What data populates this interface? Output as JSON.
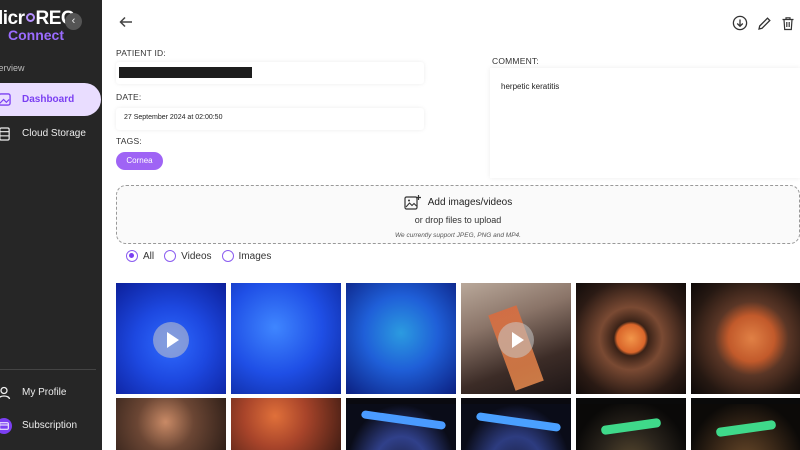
{
  "sidebar": {
    "logo_line1": "licr",
    "logo_line1b": "REC",
    "logo_line2": "Connect",
    "collapse_icon": "chevron-left-icon",
    "section": "verview",
    "items": [
      {
        "label": "Dashboard",
        "icon": "image-icon",
        "active": true
      },
      {
        "label": "Cloud Storage",
        "icon": "storage-icon",
        "active": false
      }
    ],
    "bottom": [
      {
        "label": "My Profile",
        "icon": "user-icon"
      },
      {
        "label": "Subscription",
        "icon": "subscription-icon"
      }
    ]
  },
  "header": {
    "back_icon": "arrow-left-icon",
    "actions": [
      "download-icon",
      "edit-icon",
      "delete-icon"
    ]
  },
  "form": {
    "patient_id_label": "PATIENT ID:",
    "patient_id_value": "",
    "date_label": "DATE:",
    "date_value": "27 September 2024 at 02:00:50",
    "tags_label": "TAGS:",
    "tags": [
      "Cornea"
    ],
    "comment_label": "COMMENT:",
    "comment_value": "herpetic keratitis"
  },
  "upload": {
    "title": "Add images/videos",
    "subtitle": "or drop files to upload",
    "note": "We currently support JPEG, PNG and MP4."
  },
  "filters": {
    "options": [
      "All",
      "Videos",
      "Images"
    ],
    "selected": "All"
  },
  "media": [
    {
      "kind": "video",
      "theme": "fluorescein-blue"
    },
    {
      "kind": "image",
      "theme": "fluorescein-blue"
    },
    {
      "kind": "image",
      "theme": "fluorescein-blue-green"
    },
    {
      "kind": "video",
      "theme": "surgical"
    },
    {
      "kind": "image",
      "theme": "slit-lamp-orange"
    },
    {
      "kind": "image",
      "theme": "slit-lamp-orange"
    },
    {
      "kind": "image",
      "theme": "slit-lamp-dark"
    },
    {
      "kind": "image",
      "theme": "slit-lamp-red"
    },
    {
      "kind": "image",
      "theme": "slit-beam-blue"
    },
    {
      "kind": "image",
      "theme": "slit-beam-blue"
    },
    {
      "kind": "image",
      "theme": "slit-beam-green"
    },
    {
      "kind": "image",
      "theme": "slit-beam-green"
    }
  ],
  "colors": {
    "accent": "#7b3ff2",
    "tag_bg": "#9f64f5",
    "sidebar_bg": "#262626",
    "active_nav_bg": "#e9ddff"
  }
}
